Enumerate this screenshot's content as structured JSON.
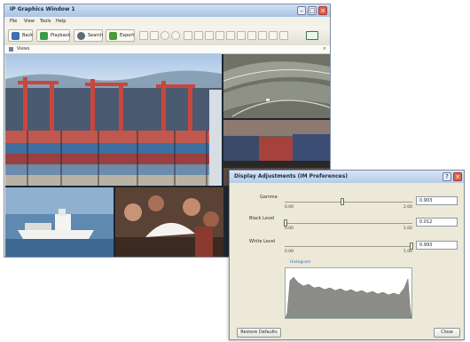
{
  "window": {
    "title": "IP Graphics Window 1",
    "menus": [
      "File",
      "View",
      "Tools",
      "Help"
    ],
    "toolbar": {
      "back": "Back",
      "playback": "Playback",
      "search": "Search",
      "export": "Export"
    },
    "address": "Views"
  },
  "dialog": {
    "title": "Display Adjustments (IM Preferences)",
    "gamma": {
      "label": "Gamma",
      "min": "0.00",
      "max": "2.00",
      "value": "0.903",
      "position": 0.45
    },
    "black_level": {
      "label": "Black Level",
      "min": "0.00",
      "max": "1.00",
      "value": "0.012",
      "position": 0.01
    },
    "white_level": {
      "label": "White Level",
      "min": "0.00",
      "max": "1.00",
      "value": "0.993",
      "position": 0.99
    },
    "histogram_label": "Histogram",
    "restore_button": "Restore Defaults",
    "close_button": "Close"
  },
  "colors": {
    "accent": "#2a5fa8",
    "titlebar": "#b4cbe8",
    "histogram_fill": "#8c8c88"
  }
}
